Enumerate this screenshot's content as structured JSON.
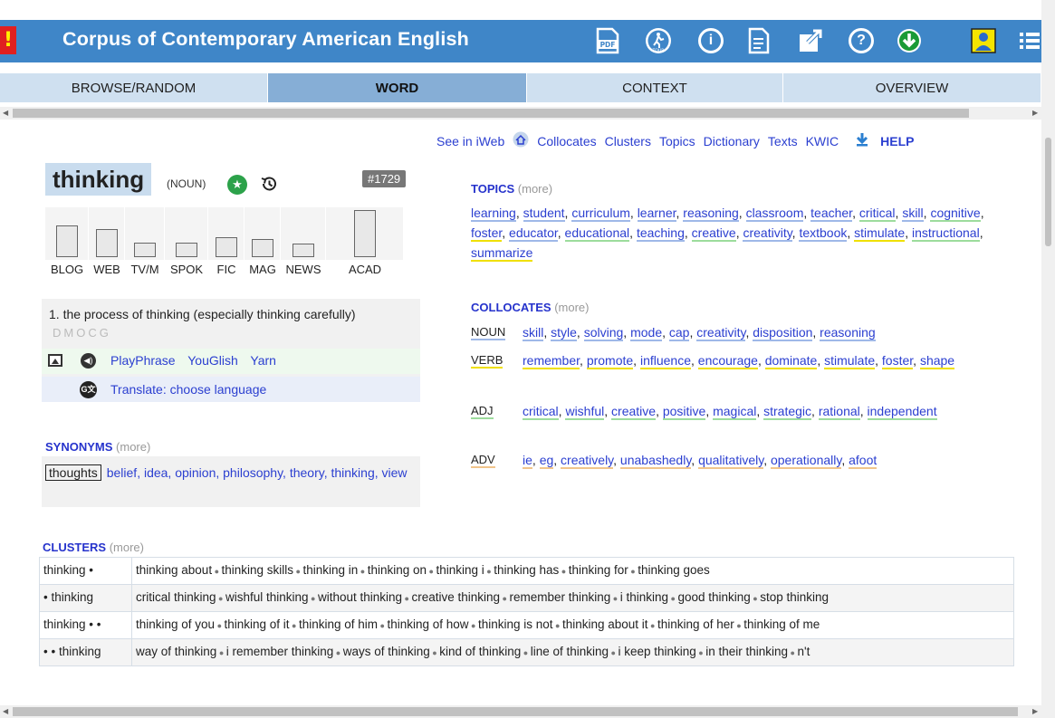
{
  "header": {
    "alert": "!",
    "title": "Corpus of Contemporary American English",
    "pdf_label": "PDF",
    "tour_label": "TOUR"
  },
  "tabs": [
    {
      "label": "BROWSE/RANDOM"
    },
    {
      "label": "WORD",
      "active": true
    },
    {
      "label": "CONTEXT"
    },
    {
      "label": "OVERVIEW"
    }
  ],
  "toplinks": {
    "iweb": "See in iWeb",
    "collocates": "Collocates",
    "clusters": "Clusters",
    "topics": "Topics",
    "dictionary": "Dictionary",
    "texts": "Texts",
    "kwic": "KWIC",
    "help": "HELP"
  },
  "word": {
    "text": "thinking",
    "pos": "(NOUN)",
    "rank": "#1729"
  },
  "frequency": {
    "genres": [
      "BLOG",
      "WEB",
      "TV/M",
      "SPOK",
      "FIC",
      "MAG",
      "NEWS",
      "ACAD"
    ],
    "relative_height": [
      0.68,
      0.6,
      0.3,
      0.3,
      0.42,
      0.38,
      0.28,
      1.0
    ]
  },
  "definition": {
    "text": "1. the process of thinking (especially thinking carefully)",
    "genres": "DMOCG",
    "media_links": [
      "PlayPhrase",
      "YouGlish",
      "Yarn"
    ],
    "translate": "Translate: choose language"
  },
  "synonyms": {
    "title": "SYNONYMS",
    "more": "(more)",
    "head": "thoughts",
    "items": "belief,  idea,  opinion,  philosophy,  theory,  thinking,  view"
  },
  "topics": {
    "title": "TOPICS",
    "more": "(more)",
    "items": [
      {
        "w": "learning",
        "c": "b"
      },
      {
        "w": "student",
        "c": "b"
      },
      {
        "w": "curriculum",
        "c": "b"
      },
      {
        "w": "learner",
        "c": "b"
      },
      {
        "w": "reasoning",
        "c": "b"
      },
      {
        "w": "classroom",
        "c": "b"
      },
      {
        "w": "teacher",
        "c": "b"
      },
      {
        "w": "critical",
        "c": "g"
      },
      {
        "w": "skill",
        "c": "b"
      },
      {
        "w": "cognitive",
        "c": "g"
      },
      {
        "w": "foster",
        "c": "y"
      },
      {
        "w": "educator",
        "c": "b"
      },
      {
        "w": "educational",
        "c": "g"
      },
      {
        "w": "teaching",
        "c": "b"
      },
      {
        "w": "creative",
        "c": "g"
      },
      {
        "w": "creativity",
        "c": "b"
      },
      {
        "w": "textbook",
        "c": "b"
      },
      {
        "w": "stimulate",
        "c": "y"
      },
      {
        "w": "instructional",
        "c": "g"
      },
      {
        "w": "summarize",
        "c": "y"
      }
    ]
  },
  "collocates": {
    "title": "COLLOCATES",
    "more": "(more)",
    "rows": [
      {
        "label": "NOUN",
        "c": "b",
        "items": [
          "skill",
          "style",
          "solving",
          "mode",
          "cap",
          "creativity",
          "disposition",
          "reasoning"
        ]
      },
      {
        "label": "VERB",
        "c": "y",
        "items": [
          "remember",
          "promote",
          "influence",
          "encourage",
          "dominate",
          "stimulate",
          "foster",
          "shape"
        ]
      },
      {
        "label": "ADJ",
        "c": "g",
        "items": [
          "critical",
          "wishful",
          "creative",
          "positive",
          "magical",
          "strategic",
          "rational",
          "independent"
        ]
      },
      {
        "label": "ADV",
        "c": "o",
        "items": [
          "ie",
          "eg",
          "creatively",
          "unabashedly",
          "qualitatively",
          "operationally",
          "afoot"
        ]
      }
    ]
  },
  "clusters": {
    "title": "CLUSTERS",
    "more": "(more)",
    "rows": [
      {
        "key": "thinking •",
        "items": [
          "thinking about",
          "thinking skills",
          "thinking in",
          "thinking on",
          "thinking i",
          "thinking has",
          "thinking for",
          "thinking goes"
        ]
      },
      {
        "key": "• thinking",
        "items": [
          "critical thinking",
          "wishful thinking",
          "without thinking",
          "creative thinking",
          "remember thinking",
          "i thinking",
          "good thinking",
          "stop thinking"
        ]
      },
      {
        "key": "thinking • •",
        "items": [
          "thinking of you",
          "thinking of it",
          "thinking of him",
          "thinking of how",
          "thinking is not",
          "thinking about it",
          "thinking of her",
          "thinking of me"
        ]
      },
      {
        "key": "• • thinking",
        "items": [
          "way of thinking",
          "i remember thinking",
          "ways of thinking",
          "kind of thinking",
          "line of thinking",
          "i keep thinking",
          "in their thinking",
          "n't"
        ]
      }
    ]
  },
  "colors": {
    "header": "#3f86c8",
    "tab": "#cfe0f0",
    "tab_active": "#86aed6",
    "link": "#2b3fd0"
  }
}
